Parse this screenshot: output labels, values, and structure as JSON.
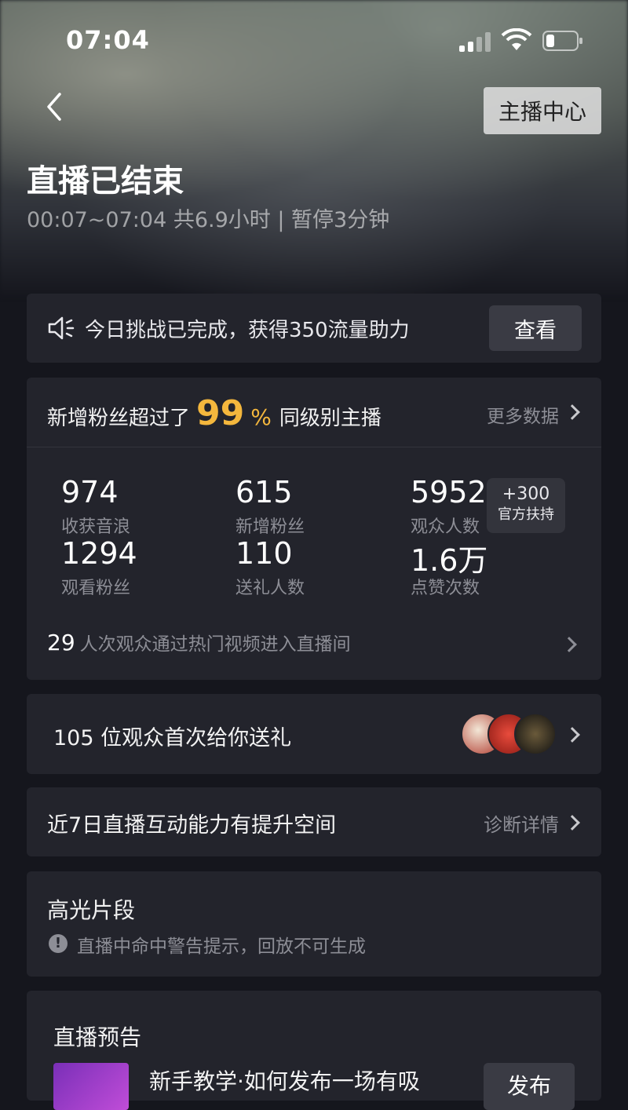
{
  "status_bar": {
    "time": "07:04"
  },
  "header": {
    "anchor_center_label": "主播中心",
    "title": "直播已结束",
    "subtitle": "00:07~07:04 共6.9小时 | 暂停3分钟"
  },
  "notice": {
    "text": "今日挑战已完成，获得350流量助力",
    "button_label": "查看"
  },
  "stats": {
    "headline_prefix": "新增粉丝超过了",
    "headline_percent": "99",
    "headline_percent_sign": "%",
    "headline_suffix": "同级别主播",
    "more_label": "更多数据",
    "metrics": [
      {
        "value": "974",
        "label": "收获音浪"
      },
      {
        "value": "615",
        "label": "新增粉丝"
      },
      {
        "value": "5952",
        "label": "观众人数"
      },
      {
        "value": "1294",
        "label": "观看粉丝"
      },
      {
        "value": "110",
        "label": "送礼人数"
      },
      {
        "value": "1.6万",
        "label": "点赞次数"
      }
    ],
    "support_badge": {
      "amount": "+300",
      "label": "官方扶持"
    },
    "hot_count": "29",
    "hot_text": "人次观众通过热门视频进入直播间"
  },
  "gift": {
    "text": "105 位观众首次给你送礼"
  },
  "diagnosis": {
    "text": "近7日直播互动能力有提升空间",
    "link_label": "诊断详情"
  },
  "highlight": {
    "title": "高光片段",
    "warning": "直播中命中警告提示，回放不可生成"
  },
  "preview": {
    "title": "直播预告",
    "course": "新手教学·如何发布一场有吸",
    "button_label": "发布"
  },
  "colors": {
    "background": "#15161d",
    "card": "#23242c",
    "accent": "#f4b73d",
    "muted": "#8d8e96"
  }
}
